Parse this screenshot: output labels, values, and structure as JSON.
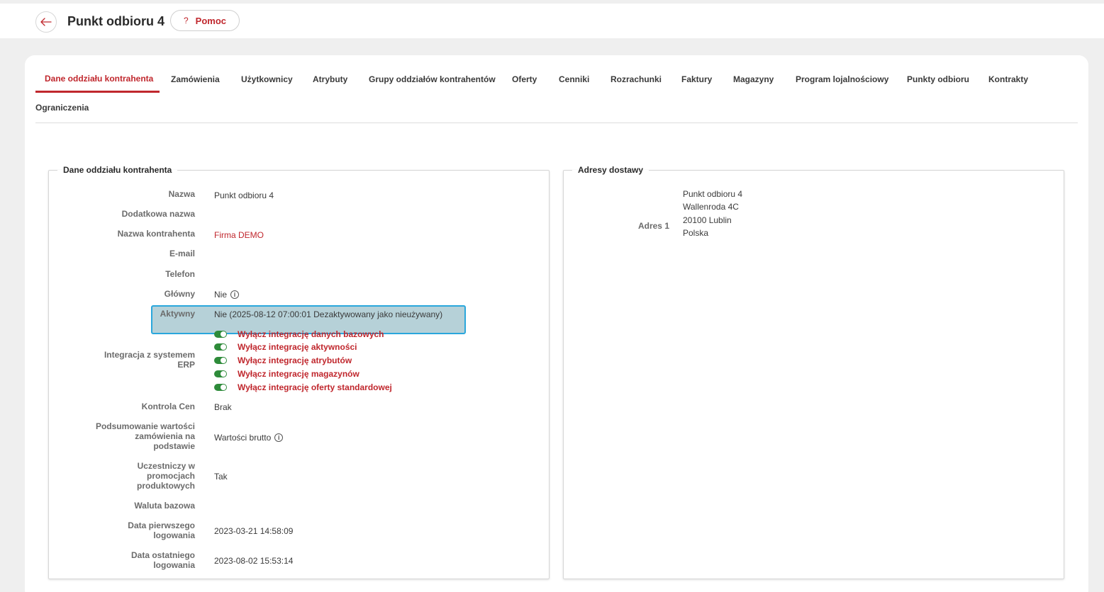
{
  "header": {
    "title": "Punkt odbioru 4",
    "help_label": "Pomoc",
    "help_glyph": "?"
  },
  "tabs": [
    {
      "label": "Dane oddziału kontrahenta",
      "active": true
    },
    {
      "label": "Zamówienia"
    },
    {
      "label": "Użytkownicy"
    },
    {
      "label": "Atrybuty"
    },
    {
      "label": "Grupy oddziałów kontrahentów"
    },
    {
      "label": "Oferty"
    },
    {
      "label": "Cenniki"
    },
    {
      "label": "Rozrachunki"
    },
    {
      "label": "Faktury"
    },
    {
      "label": "Magazyny"
    },
    {
      "label": "Program lojalnościowy"
    },
    {
      "label": "Punkty odbioru"
    },
    {
      "label": "Kontrakty"
    },
    {
      "label": "Ograniczenia"
    }
  ],
  "details": {
    "legend": "Dane oddziału kontrahenta",
    "fields": {
      "nazwa": {
        "label": "Nazwa",
        "value": "Punkt odbioru 4"
      },
      "dodatkowa": {
        "label": "Dodatkowa nazwa",
        "value": ""
      },
      "kontrahent": {
        "label": "Nazwa kontrahenta",
        "value": "Firma DEMO"
      },
      "email": {
        "label": "E-mail",
        "value": ""
      },
      "telefon": {
        "label": "Telefon",
        "value": ""
      },
      "glowny": {
        "label": "Główny",
        "value": "Nie"
      },
      "aktywny": {
        "label": "Aktywny",
        "value": "Nie (2025-08-12 07:00:01 Dezaktywowany jako nieużywany)"
      },
      "integracja": {
        "label_line1": "Integracja z systemem",
        "label_line2": "ERP"
      },
      "kontrola": {
        "label": "Kontrola Cen",
        "value": "Brak"
      },
      "podsumowanie": {
        "label_line1": "Podsumowanie wartości",
        "label_line2": "zamówienia na",
        "label_line3": "podstawie",
        "value": "Wartości brutto"
      },
      "promocje": {
        "label_line1": "Uczestniczy w",
        "label_line2": "promocjach",
        "label_line3": "produktowych",
        "value": "Tak"
      },
      "waluta": {
        "label": "Waluta bazowa",
        "value": ""
      },
      "pierwsze": {
        "label_line1": "Data pierwszego",
        "label_line2": "logowania",
        "value": "2023-03-21 14:58:09"
      },
      "ostatnie": {
        "label_line1": "Data ostatniego",
        "label_line2": "logowania",
        "value": "2023-08-02 15:53:14"
      }
    },
    "integrations": [
      {
        "label": "Wyłącz integrację danych bazowych",
        "on": true
      },
      {
        "label": "Wyłącz integrację aktywności",
        "on": true
      },
      {
        "label": "Wyłącz integrację atrybutów",
        "on": true
      },
      {
        "label": "Wyłącz integrację magazynów",
        "on": true
      },
      {
        "label": "Wyłącz integrację oferty standardowej",
        "on": true
      }
    ]
  },
  "addresses": {
    "legend": "Adresy dostawy",
    "adres1": {
      "label": "Adres 1",
      "line1": "Punkt odbioru 4",
      "line2": "Wallenroda 4C",
      "line3": "20100 Lublin",
      "line4": "Polska"
    }
  },
  "colors": {
    "accent": "#c0272d",
    "toggle_on": "#2e8b3a",
    "highlight_border": "#2aa7dc"
  }
}
